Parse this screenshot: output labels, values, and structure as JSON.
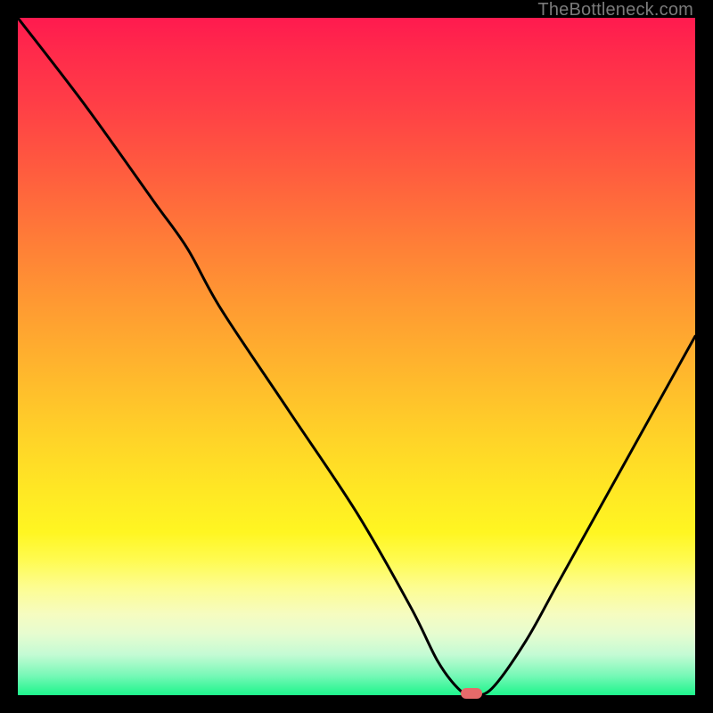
{
  "watermark": "TheBottleneck.com",
  "colors": {
    "frame": "#000000",
    "curve": "#000000",
    "marker": "#e66a6a",
    "watermark": "#7a7a7a"
  },
  "chart_data": {
    "type": "line",
    "title": "",
    "xlabel": "",
    "ylabel": "",
    "xlim": [
      0,
      100
    ],
    "ylim": [
      0,
      100
    ],
    "grid": false,
    "legend": false,
    "description": "Bottleneck curve: vertical position encodes bottleneck severity (top = 100% bottleneck / red, bottom = 0% / green). Curve reaches minimum near the marker at x≈67.",
    "series": [
      {
        "name": "bottleneck-curve",
        "x": [
          0,
          10,
          20,
          25,
          30,
          40,
          50,
          58,
          62,
          65,
          67,
          70,
          75,
          80,
          90,
          100
        ],
        "y": [
          100,
          87,
          73,
          66,
          57,
          42,
          27,
          13,
          5,
          1,
          0,
          1,
          8,
          17,
          35,
          53
        ]
      }
    ],
    "marker": {
      "x": 67,
      "y": 0
    },
    "gradient_stops": [
      {
        "pos": 0,
        "color": "#ff1a4f"
      },
      {
        "pos": 22,
        "color": "#ff5a3f"
      },
      {
        "pos": 52,
        "color": "#ffb62d"
      },
      {
        "pos": 76,
        "color": "#fff622"
      },
      {
        "pos": 100,
        "color": "#1ef58c"
      }
    ]
  }
}
